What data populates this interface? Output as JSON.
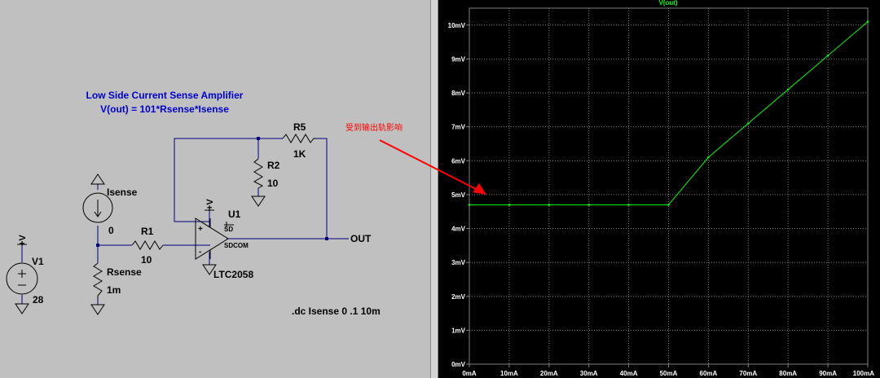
{
  "schematic": {
    "title_line1": "Low Side Current Sense Amplifier",
    "title_line2": "V(out) = 101*Rsense*Isense",
    "annotation": "受到输出轨影响",
    "directive": ".dc Isense 0 .1 10m",
    "components": {
      "isense_label": "Isense",
      "isense_node": "0",
      "r1_label": "R1",
      "r1_value": "10",
      "rsense_label": "Rsense",
      "rsense_value": "1m",
      "r2_label": "R2",
      "r2_value": "10",
      "r5_label": "R5",
      "r5_value": "1K",
      "u1_label": "U1",
      "u1_part": "LTC2058",
      "v1_label": "V1",
      "v1_value": "28",
      "supply_v1": "+V",
      "supply_u1": "+V",
      "pin_sd": "SD",
      "pin_sdcom": "SDCOM",
      "out_label": "OUT",
      "plus_sign": "+",
      "minus_sign": "-"
    }
  },
  "colors": {
    "wire": "#000080",
    "title": "#0000cc",
    "annotation": "#ff0000",
    "trace": "#00ff00",
    "grid": "#808080"
  },
  "chart_data": {
    "type": "line",
    "title": "V(out)",
    "xlabel": "",
    "ylabel": "",
    "xlim": [
      0,
      100
    ],
    "ylim": [
      0,
      10.5
    ],
    "x_ticks": [
      0,
      10,
      20,
      30,
      40,
      50,
      60,
      70,
      80,
      90,
      100
    ],
    "x_tick_labels": [
      "0mA",
      "10mA",
      "20mA",
      "30mA",
      "40mA",
      "50mA",
      "60mA",
      "70mA",
      "80mA",
      "90mA",
      "100mA"
    ],
    "y_ticks": [
      0,
      1,
      2,
      3,
      4,
      5,
      6,
      7,
      8,
      9,
      10
    ],
    "y_tick_labels": [
      "0mV",
      "1mV",
      "2mV",
      "3mV",
      "4mV",
      "5mV",
      "6mV",
      "7mV",
      "8mV",
      "9mV",
      "10mV"
    ],
    "grid": true,
    "series": [
      {
        "name": "V(out)",
        "x": [
          0,
          10,
          20,
          30,
          40,
          50,
          60,
          70,
          80,
          90,
          100
        ],
        "y": [
          4.7,
          4.7,
          4.7,
          4.7,
          4.7,
          4.7,
          6.1,
          7.1,
          8.1,
          9.1,
          10.1
        ]
      }
    ]
  }
}
